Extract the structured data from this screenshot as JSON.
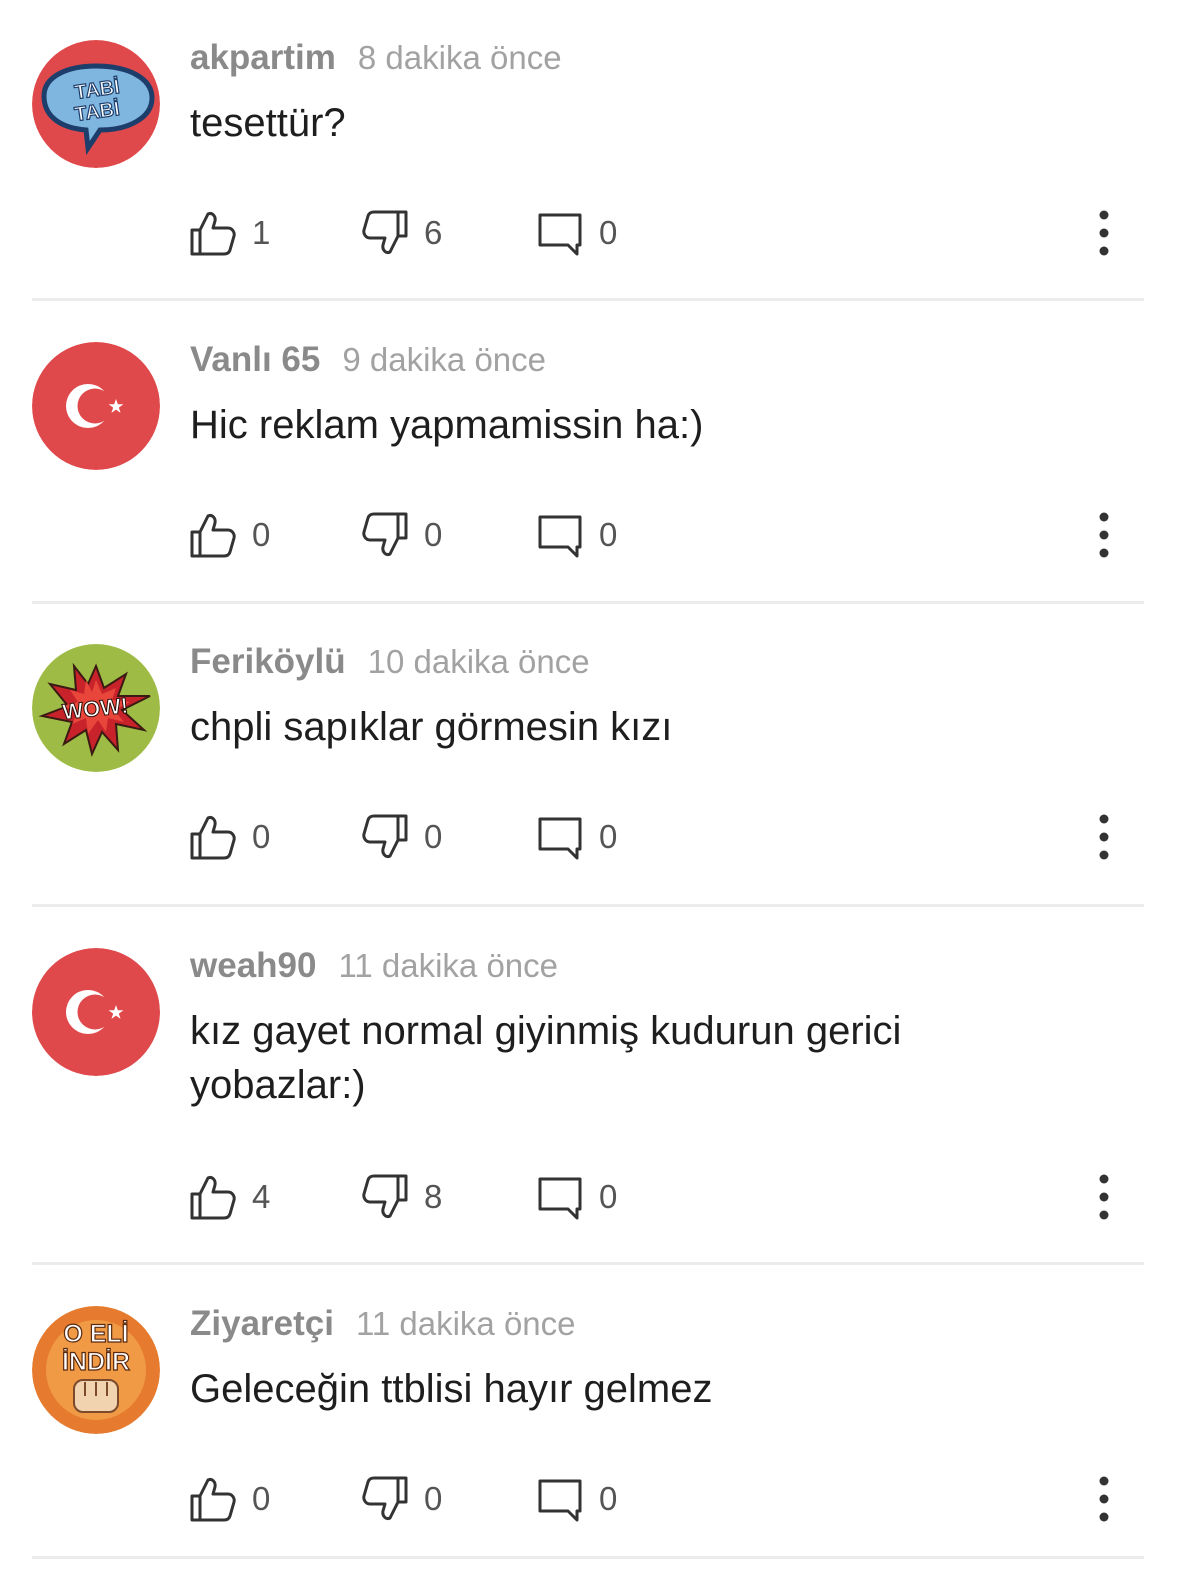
{
  "colors": {
    "avatar_red": "#e0494b",
    "avatar_green": "#9dbb45",
    "avatar_orange": "#e67a2e",
    "username": "#8a8a8a",
    "timestamp": "#a2a2a2",
    "divider": "#ececec"
  },
  "comments": [
    {
      "username": "akpartim",
      "time": "8 dakika önce",
      "text": "tesettür?",
      "likes": "1",
      "dislikes": "6",
      "replies": "0",
      "avatar": {
        "icon": "tabi-tabi-speech-bubble-avatar",
        "lines": [
          "TABİ",
          "TABİ"
        ]
      }
    },
    {
      "username": "Vanlı 65",
      "time": "9 dakika önce",
      "text": "Hic reklam yapmamissin ha:)",
      "likes": "0",
      "dislikes": "0",
      "replies": "0",
      "avatar": {
        "icon": "turkish-flag-avatar"
      }
    },
    {
      "username": "Feriköylü",
      "time": "10 dakika önce",
      "text": "chpli sapıklar görmesin kızı",
      "likes": "0",
      "dislikes": "0",
      "replies": "0",
      "avatar": {
        "icon": "wow-burst-avatar",
        "lines": [
          "WOW!"
        ]
      }
    },
    {
      "username": "weah90",
      "time": "11 dakika önce",
      "text": "kız gayet normal giyinmiş kudurun gerici yobazlar:)",
      "likes": "4",
      "dislikes": "8",
      "replies": "0",
      "avatar": {
        "icon": "turkish-flag-avatar"
      }
    },
    {
      "username": "Ziyaretçi",
      "time": "11 dakika önce",
      "text": "Geleceğin ttblisi hayır gelmez",
      "likes": "0",
      "dislikes": "0",
      "replies": "0",
      "avatar": {
        "icon": "o-eli-indir-fist-avatar",
        "lines": [
          "O ELİ",
          "İNDİR"
        ]
      }
    }
  ]
}
